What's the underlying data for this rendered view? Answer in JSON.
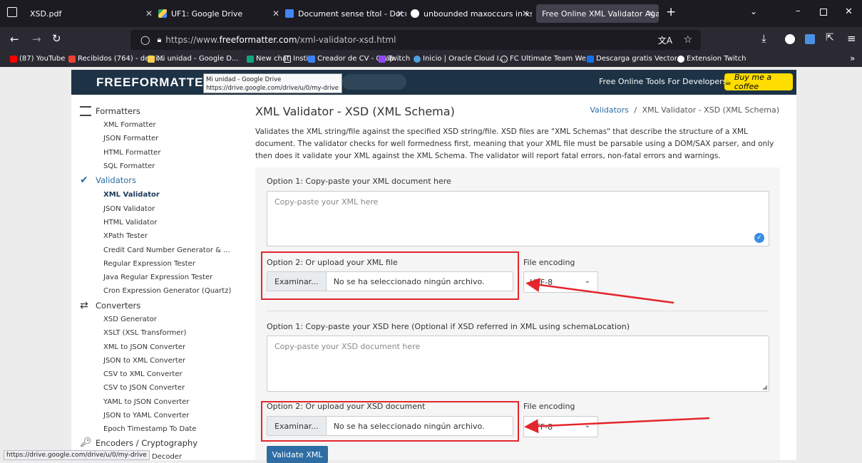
{
  "browser": {
    "tabs": [
      {
        "title": "XSD.pdf",
        "active": false
      },
      {
        "title": "UF1: Google Drive",
        "active": false
      },
      {
        "title": "Document sense títol - Docume",
        "active": false
      },
      {
        "title": "unbounded maxoccurs in xsd - ",
        "active": false
      },
      {
        "title": "Free Online XML Validator Against",
        "active": true
      }
    ],
    "url_prefix": "https://www.",
    "url_domain": "freeformatter.com",
    "url_path": "/xml-validator-xsd.html",
    "bookmarks": [
      "(87) YouTube",
      "Recibidos (764) - deivi...",
      "Mi unidad - Google D...",
      "New chat",
      "Insti",
      "Creador de CV - CVap...",
      "Twitch",
      "Inicio | Oracle Cloud I...",
      "FC Ultimate Team We...",
      "Descarga gratis Vector...",
      "Extension Twitch"
    ],
    "tooltip_title": "Mi unidad - Google Drive",
    "tooltip_url": "https://drive.google.com/drive/u/0/my-drive",
    "status_url": "https://drive.google.com/drive/u/0/my-drive"
  },
  "header": {
    "logo": "FREEFORMATTER.COM",
    "tagline": "Free Online Tools For Developers",
    "coffee": "Buy me a coffee"
  },
  "sidebar": {
    "formatters": {
      "label": "Formatters",
      "items": [
        "XML Formatter",
        "JSON Formatter",
        "HTML Formatter",
        "SQL Formatter"
      ]
    },
    "validators": {
      "label": "Validators",
      "items": [
        "XML Validator",
        "JSON Validator",
        "HTML Validator",
        "XPath Tester",
        "Credit Card Number Generator & ...",
        "Regular Expression Tester",
        "Java Regular Expression Tester",
        "Cron Expression Generator (Quartz)"
      ]
    },
    "converters": {
      "label": "Converters",
      "items": [
        "XSD Generator",
        "XSLT (XSL Transformer)",
        "XML to JSON Converter",
        "JSON to XML Converter",
        "CSV to XML Converter",
        "CSV to JSON Converter",
        "YAML to JSON Converter",
        "JSON to YAML Converter",
        "Epoch Timestamp To Date"
      ]
    },
    "encoders": {
      "label": "Encoders / Cryptography",
      "item_partial": "& Decoder"
    }
  },
  "main": {
    "title": "XML Validator - XSD (XML Schema)",
    "breadcrumb_link": "Validators",
    "breadcrumb_sep": "/",
    "breadcrumb_current": "XML Validator - XSD (XML Schema)",
    "description": "Validates the XML string/file against the specified XSD string/file. XSD files are \"XML Schemas\" that describe the structure of a XML document. The validator checks for well formedness first, meaning that your XML file must be parsable using a DOM/SAX parser, and only then does it validate your XML against the XML Schema. The validator will report fatal errors, non-fatal errors and warnings.",
    "xml_option1_label": "Option 1: Copy-paste your XML document here",
    "xml_placeholder": "Copy-paste your XML here",
    "xml_option2_label": "Option 2: Or upload your XML file",
    "xsd_option1_label": "Option 1: Copy-paste your XSD here (Optional if XSD referred in XML using schemaLocation)",
    "xsd_placeholder": "Copy-paste your XSD document here",
    "xsd_option2_label": "Option 2: Or upload your XSD document",
    "file_button": "Examinar...",
    "file_none": "No se ha seleccionado ningún archivo.",
    "encoding_label": "File encoding",
    "encoding_value": "UTF-8",
    "encoding_value_partial": "UTF-8",
    "validate_button": "Validate XML"
  },
  "colors": {
    "annotation_red": "#e3262c",
    "header_bg": "#1d3245",
    "link_blue": "#2e6da4",
    "coffee_yellow": "#ffdd00"
  }
}
